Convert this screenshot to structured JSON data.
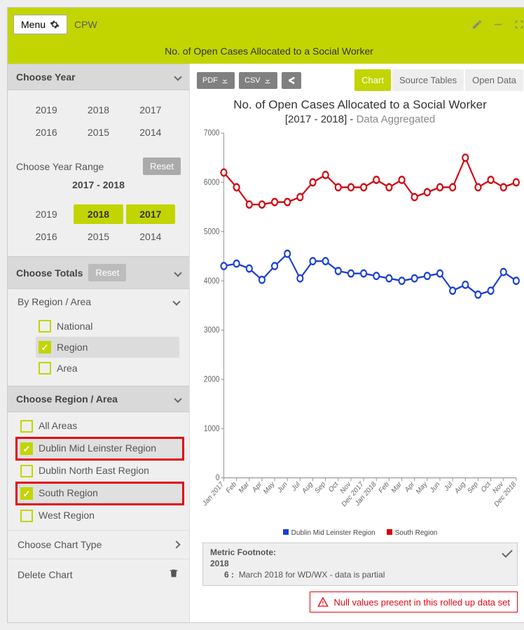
{
  "header": {
    "menu_label": "Menu",
    "app_name": "CPW",
    "subtitle": "No. of Open Cases Allocated to a Social Worker"
  },
  "sidebar": {
    "choose_year": {
      "title": "Choose Year",
      "years": [
        "2019",
        "2018",
        "2017",
        "2016",
        "2015",
        "2014"
      ]
    },
    "year_range": {
      "title": "Choose Year Range",
      "reset": "Reset",
      "label": "2017 - 2018",
      "years": [
        "2019",
        "2018",
        "2017",
        "2016",
        "2015",
        "2014"
      ],
      "selected": [
        "2018",
        "2017"
      ]
    },
    "choose_totals": {
      "title": "Choose Totals",
      "reset": "Reset",
      "by_label": "By Region / Area",
      "options": [
        {
          "label": "National",
          "checked": false
        },
        {
          "label": "Region",
          "checked": true
        },
        {
          "label": "Area",
          "checked": false
        }
      ]
    },
    "choose_region": {
      "title": "Choose Region / Area",
      "items": [
        {
          "label": "All Areas",
          "checked": false,
          "highlight": false
        },
        {
          "label": "Dublin Mid Leinster Region",
          "checked": true,
          "highlight": true
        },
        {
          "label": "Dublin North East Region",
          "checked": false,
          "highlight": false
        },
        {
          "label": "South Region",
          "checked": true,
          "highlight": true
        },
        {
          "label": "West Region",
          "checked": false,
          "highlight": false
        }
      ]
    },
    "choose_chart_type": "Choose Chart Type",
    "delete_chart": "Delete Chart"
  },
  "toolbar": {
    "pdf": "PDF",
    "csv": "CSV",
    "tabs": {
      "chart": "Chart",
      "source_tables": "Source Tables",
      "open_data": "Open Data"
    }
  },
  "chart_header": {
    "title": "No. of Open Cases Allocated to a Social Worker",
    "range": "[2017 - 2018]",
    "agg": "Data Aggregated"
  },
  "legend": {
    "s1": "Dublin Mid Leinster Region",
    "s2": "South Region"
  },
  "footnote": {
    "title": "Metric Footnote:",
    "year": "2018",
    "num": "6 :",
    "text": "March 2018 for WD/WX - data is partial"
  },
  "warning": "Null values present in this rolled up data set",
  "chart_data": {
    "type": "line",
    "title": "No. of Open Cases Allocated to a Social Worker [2017 - 2018] - Data Aggregated",
    "xlabel": "",
    "ylabel": "",
    "ylim": [
      0,
      7000
    ],
    "yticks": [
      0,
      1000,
      2000,
      3000,
      4000,
      5000,
      6000,
      7000
    ],
    "categories": [
      "Jan 2017",
      "Feb",
      "Mar",
      "Apr",
      "May",
      "Jun",
      "Jul",
      "Aug",
      "Sep",
      "Oct",
      "Nov",
      "Dec 2017",
      "Jan 2018",
      "Feb",
      "Mar",
      "Apr",
      "May",
      "Jun",
      "Jul",
      "Aug",
      "Sep",
      "Oct",
      "Nov",
      "Dec 2018"
    ],
    "series": [
      {
        "name": "Dublin Mid Leinster Region",
        "color": "#1a3fd6",
        "values": [
          4300,
          4350,
          4250,
          4020,
          4300,
          4550,
          4050,
          4400,
          4400,
          4200,
          4150,
          4150,
          4100,
          4050,
          4000,
          4050,
          4100,
          4150,
          3800,
          3920,
          3720,
          3800,
          4180,
          4000
        ]
      },
      {
        "name": "South Region",
        "color": "#d3000b",
        "values": [
          6200,
          5900,
          5550,
          5550,
          5600,
          5600,
          5700,
          6000,
          6150,
          5900,
          5900,
          5900,
          6050,
          5900,
          6050,
          5700,
          5800,
          5900,
          5900,
          6500,
          5900,
          6050,
          5900,
          6000
        ]
      }
    ]
  }
}
